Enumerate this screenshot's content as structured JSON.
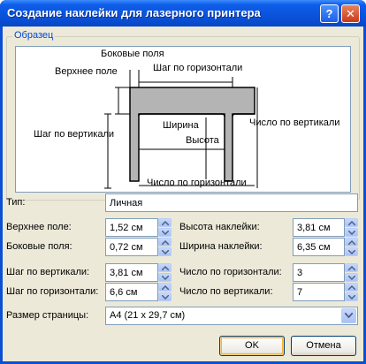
{
  "window": {
    "title": "Создание наклейки для лазерного принтера",
    "help_button": "?",
    "close_button": "✕"
  },
  "sample": {
    "group_label": "Образец",
    "diagram_labels": {
      "side_margin": "Боковые поля",
      "horizontal_pitch_top": "Шаг по горизонтали",
      "top_margin": "Верхнее поле",
      "vertical_pitch": "Шаг по вертикали",
      "width": "Ширина",
      "height": "Высота",
      "number_down": "Число по вертикали",
      "number_across": "Число по горизонтали"
    }
  },
  "form": {
    "type_label": "Тип:",
    "type_value": "Личная",
    "top_margin_label": "Верхнее поле:",
    "top_margin_value": "1,52 см",
    "side_margin_label": "Боковые поля:",
    "side_margin_value": "0,72 см",
    "vertical_pitch_label": "Шаг по вертикали:",
    "vertical_pitch_value": "3,81 см",
    "horizontal_pitch_label": "Шаг по горизонтали:",
    "horizontal_pitch_value": "6,6 см",
    "label_height_label": "Высота наклейки:",
    "label_height_value": "3,81 см",
    "label_width_label": "Ширина наклейки:",
    "label_width_value": "6,35 см",
    "number_across_label": "Число по горизонтали:",
    "number_across_value": "3",
    "number_down_label": "Число по вертикали:",
    "number_down_value": "7",
    "page_size_label": "Размер страницы:",
    "page_size_value": "A4 (21 x 29,7 см)"
  },
  "buttons": {
    "ok": "OK",
    "cancel": "Отмена"
  }
}
